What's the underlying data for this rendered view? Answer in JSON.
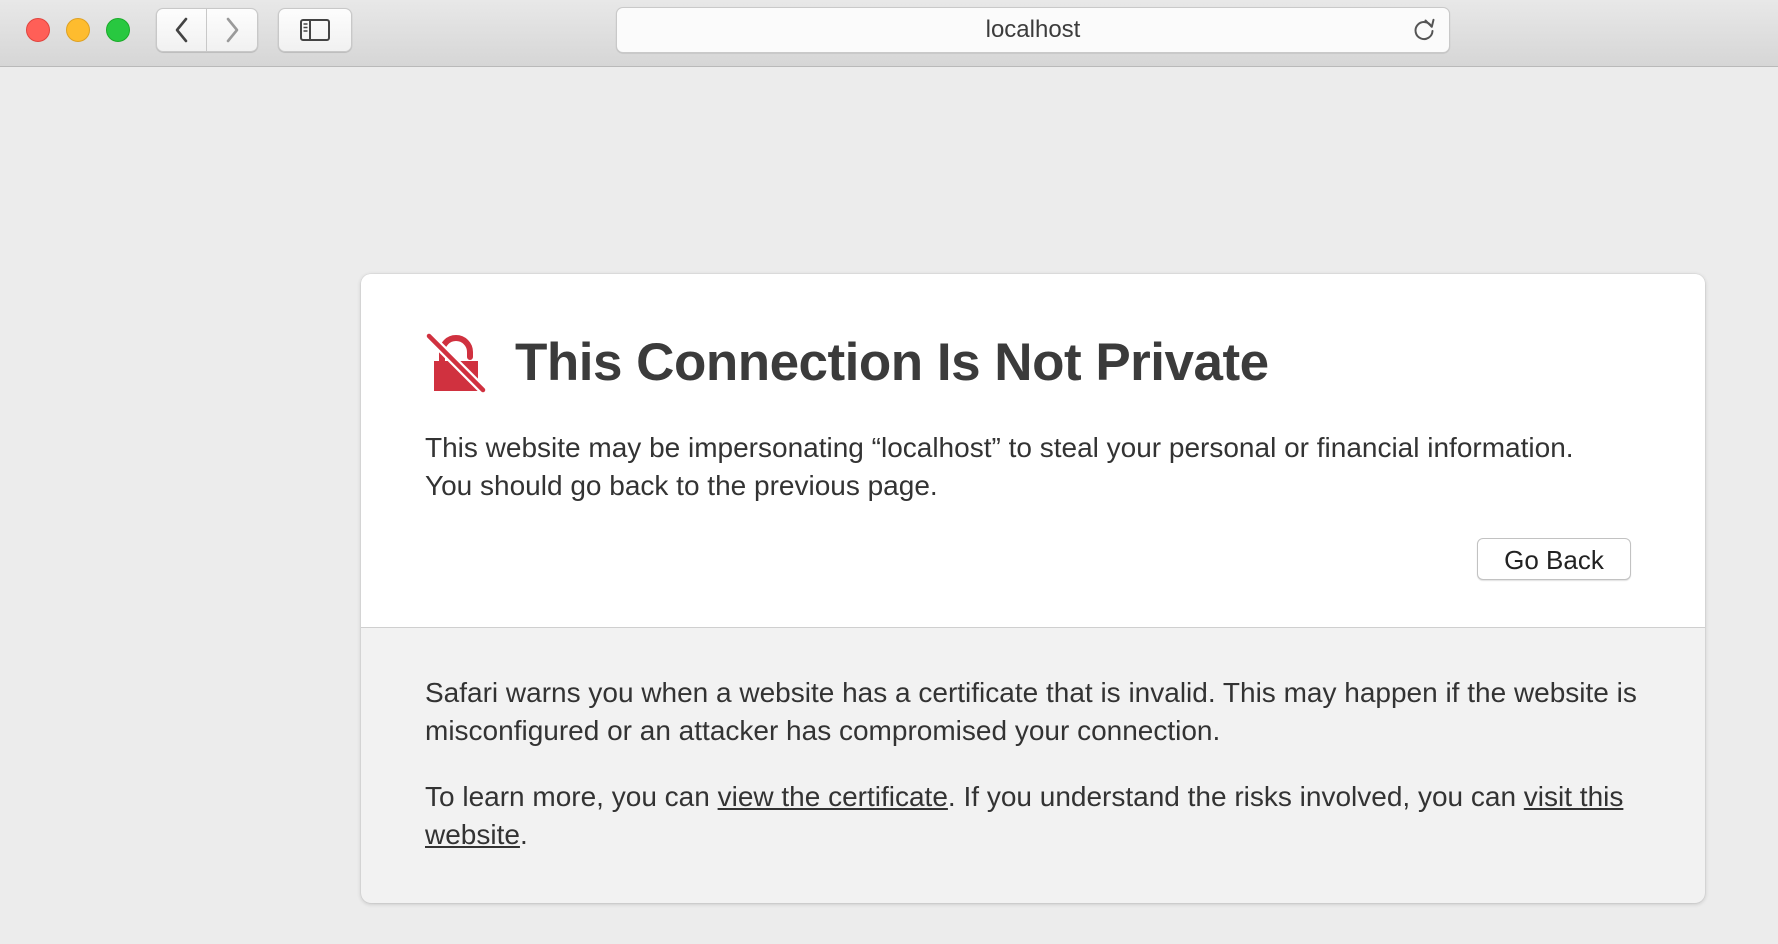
{
  "toolbar": {
    "url": "localhost"
  },
  "card": {
    "title": "This Connection Is Not Private",
    "desc_line1": "This website may be impersonating “localhost” to steal your personal or financial information.",
    "desc_line2": "You should go back to the previous page.",
    "go_back_label": "Go Back",
    "warning_text": "Safari warns you when a website has a certificate that is invalid. This may happen if the website is misconfigured or an attacker has compromised your connection.",
    "learn_prefix": "To learn more, you can ",
    "view_cert_link": "view the certificate",
    "learn_middle": ". If you understand the risks involved, you can ",
    "visit_link": "visit this website",
    "learn_suffix": "."
  },
  "colors": {
    "warning_red": "#d0313f",
    "close": "#ff5f57",
    "minimize": "#febc2e",
    "maximize": "#28c840"
  },
  "icons": {
    "back": "chevron-left-icon",
    "forward": "chevron-right-icon",
    "sidebar": "sidebar-icon",
    "reload": "reload-icon",
    "lock": "broken-lock-icon"
  }
}
